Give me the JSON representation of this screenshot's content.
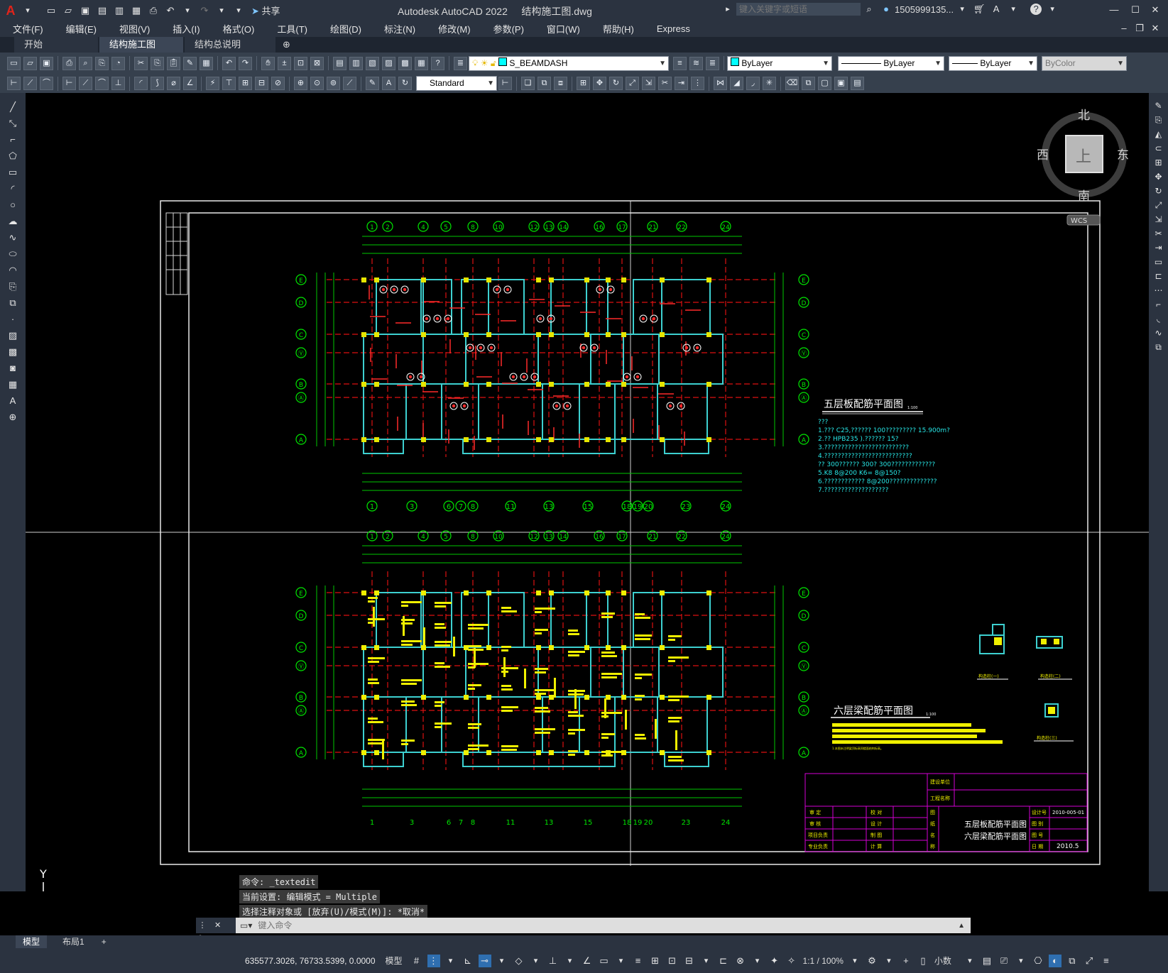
{
  "app": {
    "title": "Autodesk AutoCAD 2022",
    "filename": "结构施工图.dwg",
    "search_placeholder": "键入关键字或短语",
    "user": "1505999135...",
    "share_label": "共享"
  },
  "menu": [
    "文件(F)",
    "编辑(E)",
    "视图(V)",
    "插入(I)",
    "格式(O)",
    "工具(T)",
    "绘图(D)",
    "标注(N)",
    "修改(M)",
    "参数(P)",
    "窗口(W)",
    "帮助(H)",
    "Express"
  ],
  "tabs": [
    {
      "label": "开始"
    },
    {
      "label": "结构施工图*"
    },
    {
      "label": "结构总说明"
    }
  ],
  "toolbar": {
    "layer": "S_BEAMDASH",
    "color": "ByLayer",
    "linetype": "ByLayer",
    "lineweight": "ByLayer",
    "plotstyle": "ByColor",
    "textstyle": "Standard"
  },
  "viewcube": {
    "north": "北",
    "south": "南",
    "east": "东",
    "west": "西",
    "top": "上",
    "wcs": "WCS"
  },
  "drawing": {
    "axes_top": [
      "1",
      "2",
      "4",
      "5",
      "8",
      "10",
      "12",
      "13",
      "14",
      "16",
      "17",
      "21",
      "22",
      "24"
    ],
    "axes_bottom": [
      "1",
      "3",
      "6",
      "7",
      "8",
      "11",
      "13",
      "15",
      "18",
      "19",
      "20",
      "23",
      "24"
    ],
    "axes_side": [
      "E",
      "D",
      "C",
      "Ⓥ",
      "B",
      "Ⓐ",
      "A"
    ],
    "plan1_title": "五层板配筋平面图",
    "plan1_scale": "1:100",
    "plan1_notes": [
      "???",
      "1.??? C25,??????    100?????????      15.900m?",
      "2.?? HPB235  ).??????    15?",
      "3.?????????????????????????",
      "4.??????????????????????????",
      "  ?? 300??????    300? 300?????????????",
      "5.K8     8@200 K6=     8@150?",
      "6.????????????          8@200??????????????",
      "7.???????????????????"
    ],
    "plan2_title": "六层梁配筋平面图",
    "plan2_scale": "1:100",
    "plan2_footnote": "1.本图未注明梁顶标高同楼面结构标高。",
    "details": [
      {
        "label": "构造柱(一)"
      },
      {
        "label": "构造柱(二)"
      },
      {
        "label": "构造柱(三)"
      }
    ],
    "title_block": {
      "row_labels": [
        "建设单位",
        "工程名称"
      ],
      "sign_left": [
        "审 定",
        "审 核",
        "项目负责",
        "专业负责"
      ],
      "sign_mid": [
        "校 对",
        "设 计",
        "制 图",
        "计 算"
      ],
      "stamp": [
        "图",
        "纸",
        "名",
        "称"
      ],
      "drawing_name_1": "五层板配筋平面图",
      "drawing_name_2": "六层梁配筋平面图",
      "right_labels": [
        "设计号",
        "图 别",
        "图 号",
        "日 期"
      ],
      "project_no": "2010-005-01",
      "date": "2010.5"
    }
  },
  "command": {
    "history": [
      "命令: _textedit",
      "当前设置: 编辑模式 = Multiple",
      "选择注释对象或 [放弃(U)/模式(M)]: *取消*"
    ],
    "placeholder": "键入命令"
  },
  "layout_tabs": [
    "模型",
    "布局1"
  ],
  "status": {
    "coords": "635577.3026, 76733.5399, 0.0000",
    "space": "模型",
    "scale": "1:1 / 100%",
    "units": "小数"
  },
  "colors": {
    "accent": "#00ff00",
    "title_bg": "#2b3340",
    "canvas": "#000000"
  }
}
